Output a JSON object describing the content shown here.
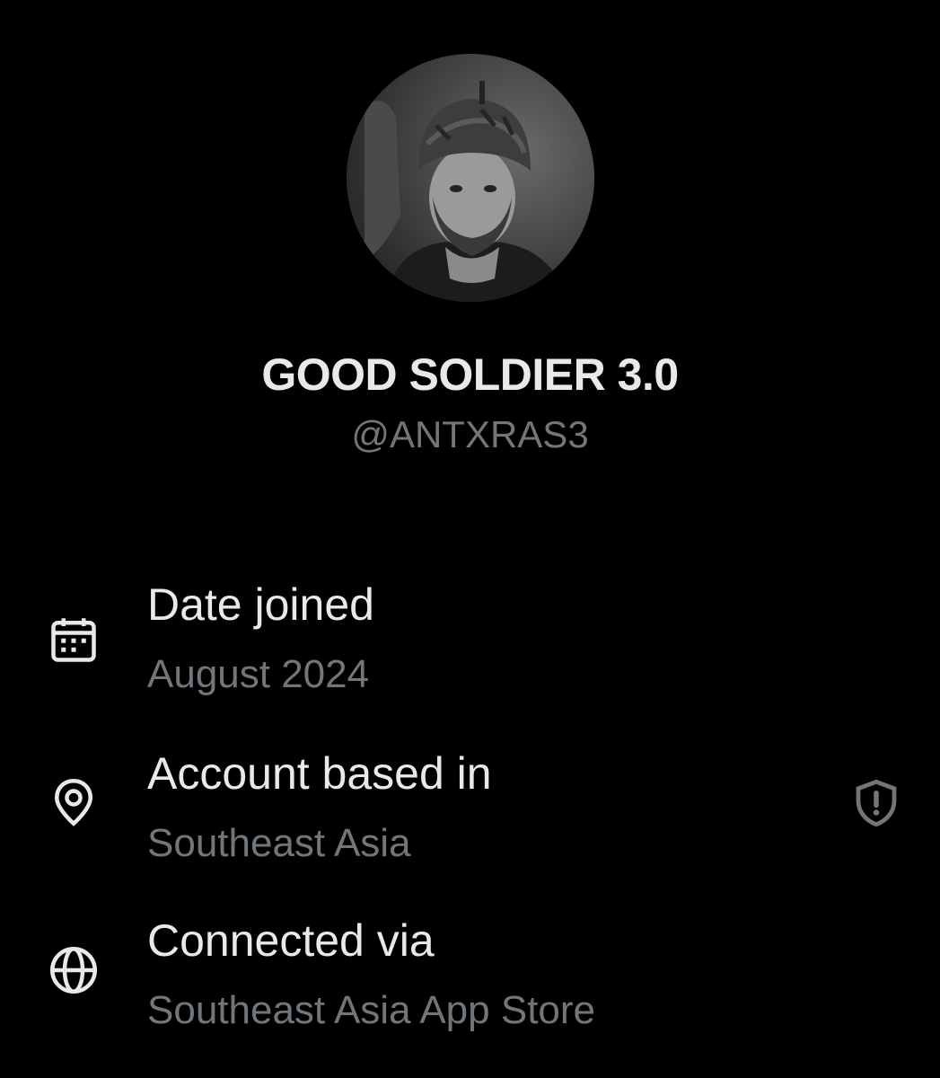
{
  "profile": {
    "display_name": "GOOD SOLDIER 3.0",
    "handle": "@ANTXRAS3",
    "avatar_icon": "soldier-portrait"
  },
  "rows": [
    {
      "icon": "calendar-icon",
      "title": "Date joined",
      "value": "August 2024"
    },
    {
      "icon": "location-pin-icon",
      "title": "Account based in",
      "value": "Southeast Asia",
      "side_icon": "shield-alert-icon"
    },
    {
      "icon": "globe-icon",
      "title": "Connected via",
      "value": "Southeast Asia App Store"
    }
  ],
  "colors": {
    "background": "#000000",
    "primary_text": "#e7e9ea",
    "secondary_text": "#71767b"
  }
}
